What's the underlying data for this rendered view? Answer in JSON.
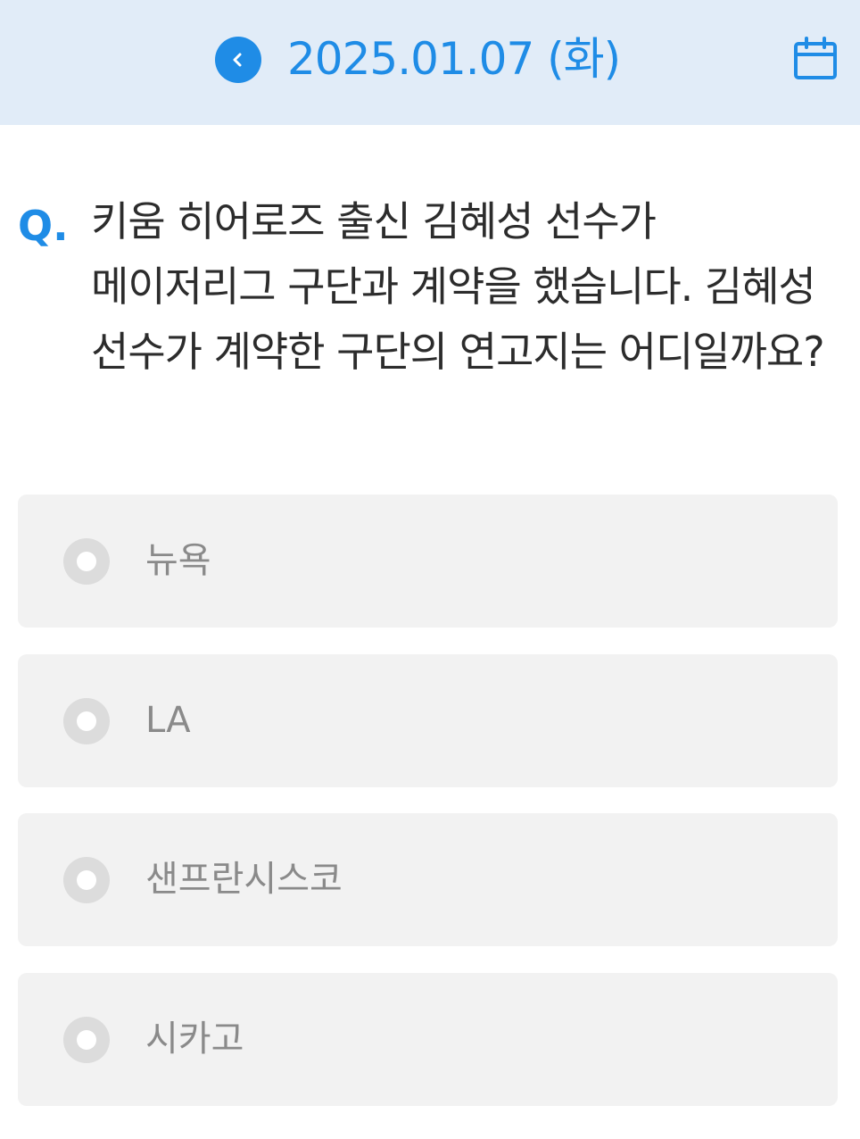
{
  "header": {
    "date": "2025.01.07 (화)",
    "back_icon": "chevron-left-icon",
    "calendar_icon": "calendar-icon",
    "accent_color": "#1f8ce6",
    "background_color": "#e1ecf8"
  },
  "question": {
    "marker": "Q.",
    "text": "키움 히어로즈 출신 김혜성 선수가 메이저리그 구단과 계약을 했습니다. 김혜성 선수가 계약한 구단의 연고지는 어디일까요?"
  },
  "options": [
    {
      "label": "뉴욕"
    },
    {
      "label": "LA"
    },
    {
      "label": "샌프란시스코"
    },
    {
      "label": "시카고"
    }
  ]
}
